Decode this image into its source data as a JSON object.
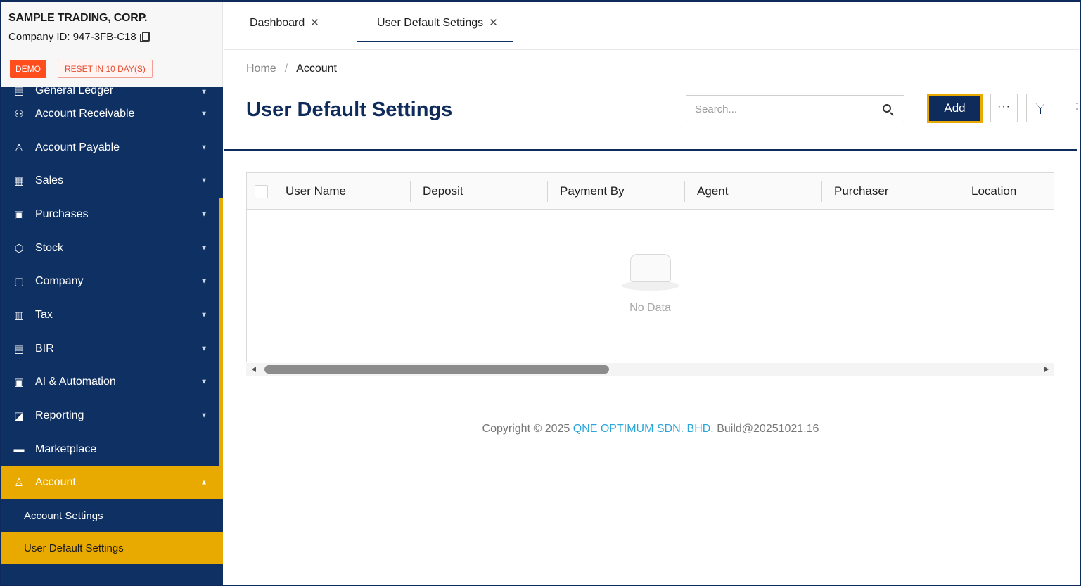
{
  "company": {
    "name": "SAMPLE TRADING, CORP.",
    "id_label": "Company ID: 947-3FB-C18",
    "demo_badge": "DEMO",
    "reset_badge": "RESET IN 10 DAY(S)"
  },
  "sidebar": {
    "items": [
      {
        "label": "General Ledger",
        "icon": "ledger-icon"
      },
      {
        "label": "Account Receivable",
        "icon": "receivable-icon"
      },
      {
        "label": "Account Payable",
        "icon": "payable-icon"
      },
      {
        "label": "Sales",
        "icon": "cart-icon"
      },
      {
        "label": "Purchases",
        "icon": "purchases-icon"
      },
      {
        "label": "Stock",
        "icon": "box-icon"
      },
      {
        "label": "Company",
        "icon": "company-icon"
      },
      {
        "label": "Tax",
        "icon": "tax-icon"
      },
      {
        "label": "BIR",
        "icon": "bir-icon"
      },
      {
        "label": "AI & Automation",
        "icon": "robot-icon"
      },
      {
        "label": "Reporting",
        "icon": "chart-icon"
      },
      {
        "label": "Marketplace",
        "icon": "store-icon"
      },
      {
        "label": "Account",
        "icon": "user-icon"
      }
    ],
    "sub_items": [
      {
        "label": "Account Settings"
      },
      {
        "label": "User Default Settings"
      }
    ],
    "accent_color": "#e8a900",
    "bg_color": "#0f3063"
  },
  "tabs": [
    {
      "label": "Dashboard",
      "active": false
    },
    {
      "label": "User Default Settings",
      "active": true
    }
  ],
  "breadcrumb": {
    "home": "Home",
    "separator": "/",
    "current": "Account"
  },
  "page": {
    "title": "User Default Settings"
  },
  "toolbar": {
    "search_placeholder": "Search...",
    "add_label": "Add",
    "more_label": "···",
    "right_edge_mark": ":"
  },
  "table": {
    "columns": [
      "User Name",
      "Deposit",
      "Payment By",
      "Agent",
      "Purchaser",
      "Location"
    ],
    "rows": [],
    "empty_text": "No Data"
  },
  "footer": {
    "prefix": "Copyright © 2025 ",
    "company_link": "QNE OPTIMUM SDN. BHD.",
    "build": " Build@20251021.16"
  }
}
